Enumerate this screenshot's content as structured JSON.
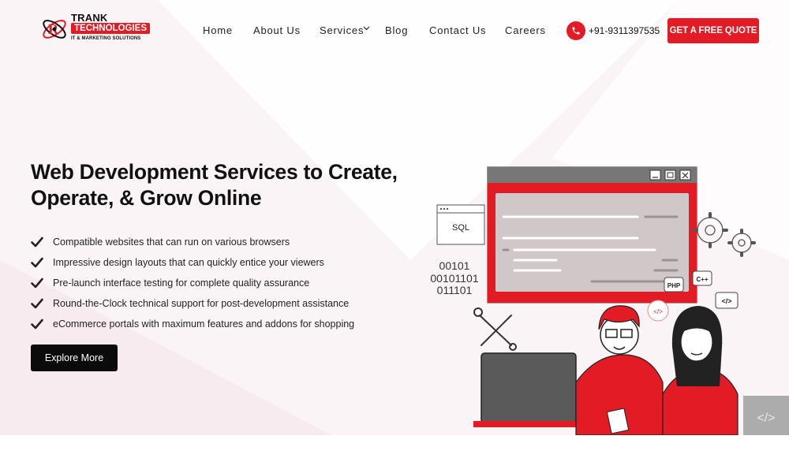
{
  "brand": {
    "name_line1": "TRANK",
    "name_line2": "TECHNOLOGIES",
    "tagline": "IT & MARKETING SOLUTIONS"
  },
  "nav": {
    "items": [
      {
        "label": "Home"
      },
      {
        "label": "About Us"
      },
      {
        "label": "Services"
      },
      {
        "label": "Blog"
      },
      {
        "label": "Contact Us"
      },
      {
        "label": "Careers"
      }
    ]
  },
  "contact": {
    "phone": "+91-9311397535"
  },
  "cta": {
    "quote_label": "GET A FREE QUOTE"
  },
  "hero": {
    "title_line1": "Web Development Services to Create,",
    "title_line2": "Operate, & Grow Online",
    "features": [
      "Compatible websites that can run on various browsers",
      "Impressive design layouts that can quickly entice your viewers",
      "Pre-launch interface testing for complete quality assurance",
      "Round-the-Clock technical support for post-development assistance",
      "eCommerce portals with maximum features and addons for shopping"
    ],
    "explore_label": "Explore More"
  },
  "illustration": {
    "sql_label": "SQL",
    "binary_lines": [
      "00101",
      "00101101",
      "011101"
    ],
    "badges": [
      "PHP",
      "C++",
      "</>",
      "</>"
    ]
  },
  "colors": {
    "accent": "#e21b24",
    "dark_button": "#0b0b0b",
    "hero_bg": "#fbf4f6"
  }
}
